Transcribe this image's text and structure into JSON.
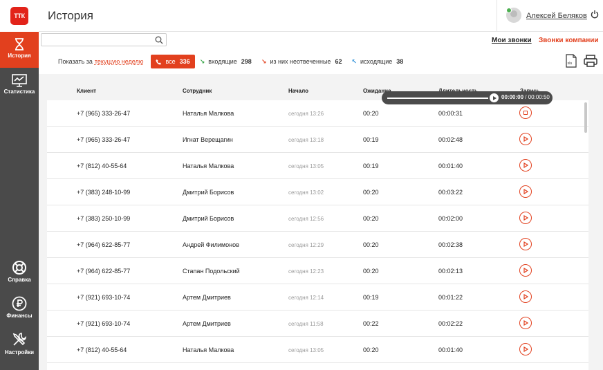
{
  "app": {
    "logo_text": "ТТК"
  },
  "header": {
    "title": "История",
    "user_name": "Алексей Беляков"
  },
  "sidebar": {
    "items": [
      {
        "label": "История",
        "icon": "hourglass-icon",
        "active": true
      },
      {
        "label": "Статистика",
        "icon": "chart-icon",
        "active": false
      },
      {
        "label": "Справка",
        "icon": "lifebuoy-icon",
        "active": false
      },
      {
        "label": "Финансы",
        "icon": "ruble-icon",
        "active": false
      },
      {
        "label": "Настройки",
        "icon": "tools-icon",
        "active": false
      }
    ]
  },
  "search": {
    "value": "",
    "placeholder": ""
  },
  "views": {
    "my_calls": "Мои звонки",
    "company_calls": "Звонки компании"
  },
  "filter": {
    "period_label": "Показать за",
    "period_value": "текущую неделю",
    "chips": [
      {
        "label": "все",
        "count": "336"
      },
      {
        "label": "входящие",
        "count": "298"
      },
      {
        "label": "из них неотвеченные",
        "count": "62"
      },
      {
        "label": "исходящие",
        "count": "38"
      }
    ]
  },
  "export": {
    "xls_label": "xls"
  },
  "table": {
    "headers": [
      "Клиент",
      "Сотрудник",
      "Начало",
      "Ожидание",
      "Длительность",
      "Запись"
    ],
    "rows": [
      {
        "client": "+7 (965) 333-26-47",
        "employee": "Наталья Малкова",
        "start": "сегодня 13:26",
        "wait": "00:20",
        "duration": "00:00:31",
        "playing": true
      },
      {
        "client": "+7 (965) 333-26-47",
        "employee": "Игнат Верещагин",
        "start": "сегодня 13:18",
        "wait": "00:19",
        "duration": "00:02:48",
        "playing": false
      },
      {
        "client": "+7 (812) 40-55-64",
        "employee": "Наталья Малкова",
        "start": "сегодня 13:05",
        "wait": "00:19",
        "duration": "00:01:40",
        "playing": false
      },
      {
        "client": "+7 (383) 248-10-99",
        "employee": "Дмитрий Борисов",
        "start": "сегодня 13:02",
        "wait": "00:20",
        "duration": "00:03:22",
        "playing": false
      },
      {
        "client": "+7 (383) 250-10-99",
        "employee": "Дмитрий Борисов",
        "start": "сегодня 12:56",
        "wait": "00:20",
        "duration": "00:02:00",
        "playing": false
      },
      {
        "client": "+7 (964) 622-85-77",
        "employee": "Андрей Филимонов",
        "start": "сегодня 12:29",
        "wait": "00:20",
        "duration": "00:02:38",
        "playing": false
      },
      {
        "client": "+7 (964) 622-85-77",
        "employee": "Стапан Подольский",
        "start": "сегодня 12:23",
        "wait": "00:20",
        "duration": "00:02:13",
        "playing": false
      },
      {
        "client": "+7 (921) 693-10-74",
        "employee": "Артем Дмитриев",
        "start": "сегодня 12:14",
        "wait": "00:19",
        "duration": "00:01:22",
        "playing": false
      },
      {
        "client": "+7 (921) 693-10-74",
        "employee": "Артем Дмитриев",
        "start": "сегодня 11:58",
        "wait": "00:22",
        "duration": "00:02:22",
        "playing": false
      },
      {
        "client": "+7 (812) 40-55-64",
        "employee": "Наталья Малкова",
        "start": "сегодня 13:05",
        "wait": "00:20",
        "duration": "00:01:40",
        "playing": false
      }
    ]
  },
  "player": {
    "time": "00:00:00",
    "total": "/ 00:00:50",
    "progress": 0
  },
  "colors": {
    "accent": "#e2401e",
    "sidebar": "#4a4a4a",
    "brand": "#e2231a"
  }
}
